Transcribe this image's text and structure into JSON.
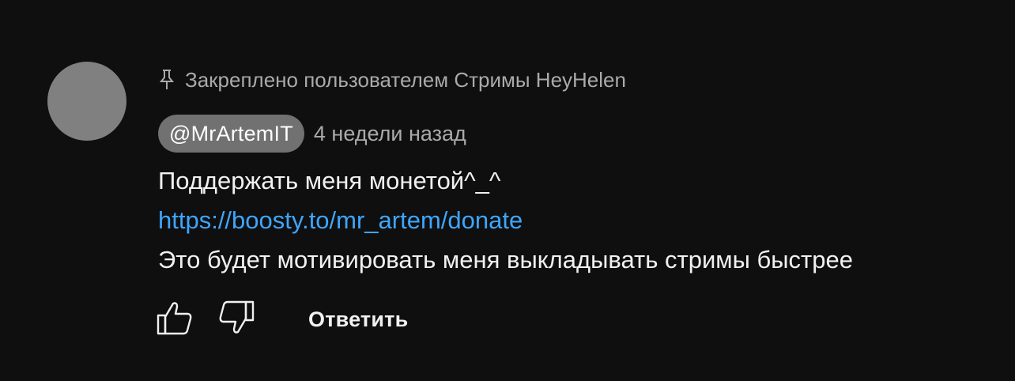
{
  "comment": {
    "pinned_text": "Закреплено пользователем Стримы HeyHelen",
    "author": "@MrArtemIT",
    "timestamp": "4 недели назад",
    "body": {
      "line1": "Поддержать меня монетой^_^",
      "link": "https://boosty.to/mr_artem/donate",
      "line3": "Это будет мотивировать меня выкладывать стримы быстрее"
    }
  },
  "actions": {
    "like_icon": "thumbs-up-icon",
    "dislike_icon": "thumbs-down-icon",
    "reply_label": "Ответить"
  },
  "colors": {
    "background": "#0f0f0f",
    "avatar": "#808080",
    "author_chip": "#717171",
    "link": "#3ea6ff",
    "secondary_text": "#aaaaaa",
    "primary_text": "#f1f1f1"
  }
}
